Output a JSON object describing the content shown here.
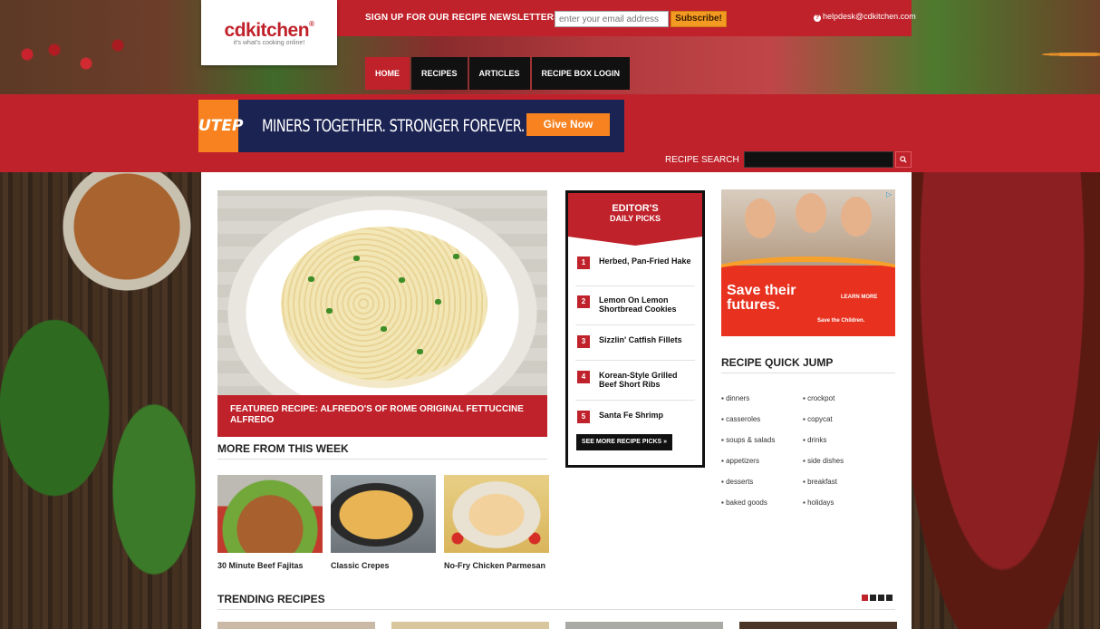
{
  "header": {
    "logo_main": "cdkitchen",
    "logo_reg": "®",
    "logo_tagline": "it's what's cooking online!",
    "newsletter_label": "SIGN UP FOR OUR RECIPE NEWSLETTERS",
    "email_placeholder": "enter your email address",
    "subscribe_label": "Subscribe!",
    "help_email": "helpdesk@cdkitchen.com"
  },
  "nav": {
    "items": [
      {
        "label": "HOME",
        "active": true
      },
      {
        "label": "RECIPES",
        "active": false
      },
      {
        "label": "ARTICLES",
        "active": false
      },
      {
        "label": "RECIPE BOX LOGIN",
        "active": false
      }
    ]
  },
  "ad_banner": {
    "logo_text": "UTEP",
    "slogan": "MINERS TOGETHER. STRONGER FOREVER.",
    "cta": "Give Now"
  },
  "search": {
    "label": "RECIPE SEARCH",
    "button_icon": "search-icon"
  },
  "featured": {
    "caption": "FEATURED RECIPE: ALFREDO'S OF ROME ORIGINAL FETTUCCINE ALFREDO"
  },
  "more_from_week": {
    "title": "MORE FROM THIS WEEK",
    "items": [
      {
        "label": "30 Minute Beef Fajitas"
      },
      {
        "label": "Classic Crepes"
      },
      {
        "label": "No-Fry Chicken Parmesan"
      }
    ]
  },
  "editors_picks": {
    "title_line1": "EDITOR'S",
    "title_line2": "DAILY PICKS",
    "items": [
      {
        "num": "1",
        "label": "Herbed, Pan-Fried Hake"
      },
      {
        "num": "2",
        "label": "Lemon On Lemon Shortbread Cookies"
      },
      {
        "num": "3",
        "label": "Sizzlin' Catfish Fillets"
      },
      {
        "num": "4",
        "label": "Korean-Style Grilled Beef Short Ribs"
      },
      {
        "num": "5",
        "label": "Santa Fe Shrimp"
      }
    ],
    "more_label": "SEE MORE RECIPE PICKS »"
  },
  "side_ad": {
    "headline": "Save their futures.",
    "learn_more": "LEARN MORE",
    "brand": "Save the Children."
  },
  "quick_jump": {
    "title": "RECIPE QUICK JUMP",
    "left": [
      "dinners",
      "casseroles",
      "soups & salads",
      "appetizers",
      "desserts",
      "baked goods"
    ],
    "right": [
      "crockpot",
      "copycat",
      "drinks",
      "side dishes",
      "breakfast",
      "holidays"
    ]
  },
  "trending": {
    "title": "TRENDING RECIPES"
  },
  "colors": {
    "brand_red": "#c0222b",
    "nav_black": "#111111",
    "subscribe_orange": "#f29a22",
    "utep_navy": "#1b2352",
    "utep_orange": "#f7821f"
  }
}
